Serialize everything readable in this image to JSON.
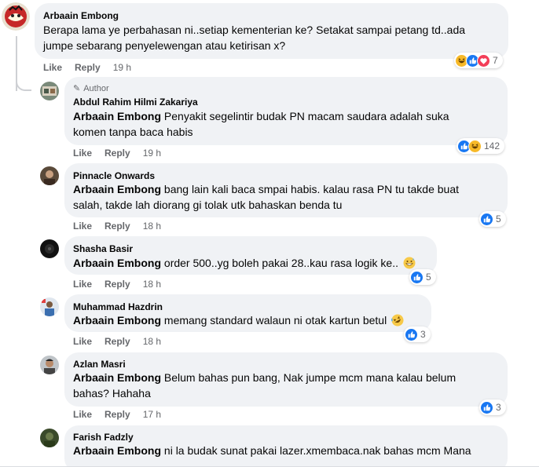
{
  "actions": {
    "like": "Like",
    "reply": "Reply"
  },
  "colors": {
    "like_blue": "#1877f2",
    "love_red": "#f33e58",
    "haha_yellow": "#f7b928",
    "bubble_bg": "#f0f2f5",
    "meta_grey": "#65676b"
  },
  "comments": [
    {
      "author": "Arbaain Embong",
      "mention": "",
      "lines": [
        "Berapa lama ye perbahasan ni..setiap kementerian ke? Setakat sampai petang td..ada",
        "jumpe sebarang penyelewengan atau ketirisan x?"
      ],
      "time": "19 h",
      "reaction_icons": [
        "haha",
        "like",
        "love"
      ],
      "reaction_count": "7"
    },
    {
      "badge": "Author",
      "author": "Abdul Rahim Hilmi Zakariya",
      "mention": "Arbaain Embong",
      "lines": [
        " Penyakit segelintir budak PN macam saudara adalah suka",
        "komen tanpa baca habis"
      ],
      "time": "19 h",
      "reaction_icons": [
        "like",
        "haha"
      ],
      "reaction_count": "142"
    },
    {
      "author": "Pinnacle Onwards",
      "mention": "Arbaain Embong",
      "lines": [
        " bang lain kali baca smpai habis. kalau rasa PN tu takde buat",
        "salah, takde lah diorang gi tolak utk bahaskan benda tu"
      ],
      "time": "18 h",
      "reaction_icons": [
        "like"
      ],
      "reaction_count": "5"
    },
    {
      "author": "Shasha Basir",
      "mention": "Arbaain Embong",
      "lines": [
        " order 500..yg boleh pakai 28..kau rasa logik ke.."
      ],
      "inline_emoji": "grinning-sweat-emoji",
      "time": "18 h",
      "reaction_icons": [
        "like"
      ],
      "reaction_count": "5"
    },
    {
      "author": "Muhammad Hazdrin",
      "mention": "Arbaain Embong",
      "lines": [
        " memang standard walaun ni otak kartun betul"
      ],
      "inline_emoji": "rofl-emoji",
      "time": "18 h",
      "reaction_icons": [
        "like"
      ],
      "reaction_count": "3"
    },
    {
      "author": "Azlan Masri",
      "mention": "Arbaain Embong",
      "lines": [
        " Belum bahas pun bang, Nak jumpe mcm mana kalau belum",
        "bahas? Hahaha"
      ],
      "time": "17 h",
      "reaction_icons": [
        "like"
      ],
      "reaction_count": "3"
    },
    {
      "author": "Farish Fadzly",
      "mention": "Arbaain Embong",
      "lines": [
        " ni la budak sunat pakai lazer.xmembaca.nak bahas mcm Mana"
      ]
    }
  ]
}
